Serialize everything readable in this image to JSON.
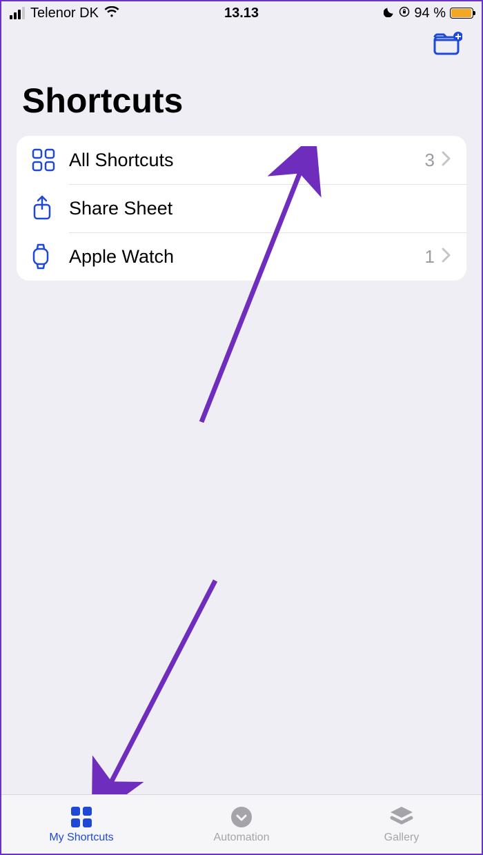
{
  "status_bar": {
    "carrier": "Telenor DK",
    "time": "13.13",
    "battery_pct": "94 %"
  },
  "header": {
    "title": "Shortcuts"
  },
  "list": {
    "items": [
      {
        "label": "All Shortcuts",
        "count": "3"
      },
      {
        "label": "Share Sheet",
        "count": ""
      },
      {
        "label": "Apple Watch",
        "count": "1"
      }
    ]
  },
  "tabs": {
    "items": [
      {
        "label": "My Shortcuts"
      },
      {
        "label": "Automation"
      },
      {
        "label": "Gallery"
      }
    ]
  },
  "colors": {
    "accent": "#1e49d6",
    "annotation": "#6f2dbd"
  }
}
